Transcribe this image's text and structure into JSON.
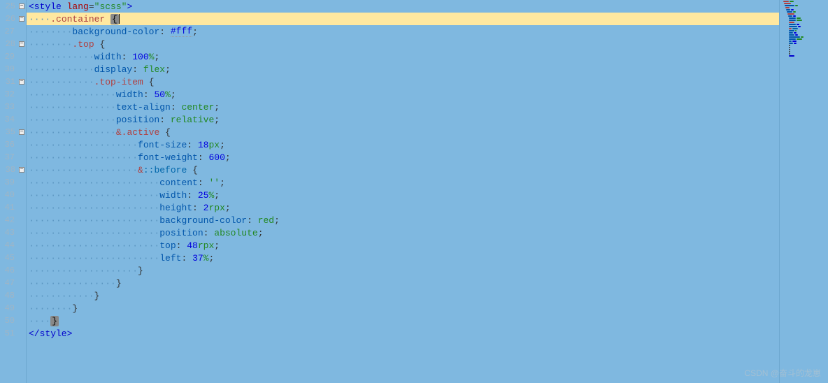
{
  "watermark": "CSDN @奋斗的龙崽",
  "startLine": 25,
  "lines": [
    {
      "n": 25,
      "fold": "-",
      "guide": "",
      "tokens": [
        [
          "tag",
          "<style "
        ],
        [
          "attr",
          "lang"
        ],
        [
          "punct",
          "="
        ],
        [
          "str",
          "\"scss\""
        ],
        [
          "tag",
          ">"
        ]
      ]
    },
    {
      "n": 26,
      "fold": "-",
      "highlight": true,
      "guide": "····",
      "tokens": [
        [
          "selcls",
          ".container "
        ],
        [
          "bracehl",
          "{"
        ]
      ],
      "cursor": true
    },
    {
      "n": 27,
      "fold": "",
      "guide": "········",
      "tokens": [
        [
          "prop",
          "background-color"
        ],
        [
          "punct",
          ": "
        ],
        [
          "num-val",
          "#fff"
        ],
        [
          "punct",
          ";"
        ]
      ],
      "underline": "#fff"
    },
    {
      "n": 28,
      "fold": "-",
      "guide": "········",
      "tokens": [
        [
          "selcls",
          ".top "
        ],
        [
          "brace",
          "{"
        ]
      ]
    },
    {
      "n": 29,
      "fold": "",
      "guide": "············",
      "tokens": [
        [
          "prop",
          "width"
        ],
        [
          "punct",
          ": "
        ],
        [
          "num-val",
          "100"
        ],
        [
          "unit",
          "%"
        ],
        [
          "punct",
          ";"
        ]
      ]
    },
    {
      "n": 30,
      "fold": "",
      "guide": "············",
      "tokens": [
        [
          "prop",
          "display"
        ],
        [
          "punct",
          ": "
        ],
        [
          "val",
          "flex"
        ],
        [
          "punct",
          ";"
        ]
      ]
    },
    {
      "n": 31,
      "fold": "-",
      "guide": "············",
      "tokens": [
        [
          "selcls",
          ".top-item "
        ],
        [
          "brace",
          "{"
        ]
      ]
    },
    {
      "n": 32,
      "fold": "",
      "guide": "················",
      "tokens": [
        [
          "prop",
          "width"
        ],
        [
          "punct",
          ": "
        ],
        [
          "num-val",
          "50"
        ],
        [
          "unit",
          "%"
        ],
        [
          "punct",
          ";"
        ]
      ]
    },
    {
      "n": 33,
      "fold": "",
      "guide": "················",
      "tokens": [
        [
          "prop",
          "text-align"
        ],
        [
          "punct",
          ": "
        ],
        [
          "val",
          "center"
        ],
        [
          "punct",
          ";"
        ]
      ]
    },
    {
      "n": 34,
      "fold": "",
      "guide": "················",
      "tokens": [
        [
          "prop",
          "position"
        ],
        [
          "punct",
          ": "
        ],
        [
          "val",
          "relative"
        ],
        [
          "punct",
          ";"
        ]
      ]
    },
    {
      "n": 35,
      "fold": "-",
      "guide": "················",
      "tokens": [
        [
          "amp",
          "&"
        ],
        [
          "selcls",
          ".active "
        ],
        [
          "brace",
          "{"
        ]
      ]
    },
    {
      "n": 36,
      "fold": "",
      "guide": "····················",
      "tokens": [
        [
          "prop",
          "font-size"
        ],
        [
          "punct",
          ": "
        ],
        [
          "num-val",
          "18"
        ],
        [
          "unit",
          "px"
        ],
        [
          "punct",
          ";"
        ]
      ]
    },
    {
      "n": 37,
      "fold": "",
      "guide": "····················",
      "tokens": [
        [
          "prop",
          "font-weight"
        ],
        [
          "punct",
          ": "
        ],
        [
          "num-val",
          "600"
        ],
        [
          "punct",
          ";"
        ]
      ]
    },
    {
      "n": 38,
      "fold": "-",
      "guide": "····················",
      "tokens": [
        [
          "amp",
          "&"
        ],
        [
          "pseudo",
          "::before "
        ],
        [
          "brace",
          "{"
        ]
      ]
    },
    {
      "n": 39,
      "fold": "",
      "guide": "························",
      "tokens": [
        [
          "prop",
          "content"
        ],
        [
          "punct",
          ": "
        ],
        [
          "str",
          "''"
        ],
        [
          "punct",
          ";"
        ]
      ]
    },
    {
      "n": 40,
      "fold": "",
      "guide": "························",
      "tokens": [
        [
          "prop",
          "width"
        ],
        [
          "punct",
          ": "
        ],
        [
          "num-val",
          "25"
        ],
        [
          "unit",
          "%"
        ],
        [
          "punct",
          ";"
        ]
      ]
    },
    {
      "n": 41,
      "fold": "",
      "guide": "························",
      "tokens": [
        [
          "prop",
          "height"
        ],
        [
          "punct",
          ": "
        ],
        [
          "num-val",
          "2"
        ],
        [
          "unit",
          "rpx"
        ],
        [
          "punct",
          ";"
        ]
      ]
    },
    {
      "n": 42,
      "fold": "",
      "guide": "························",
      "tokens": [
        [
          "prop",
          "background-color"
        ],
        [
          "punct",
          ": "
        ],
        [
          "val",
          "red"
        ],
        [
          "punct",
          ";"
        ]
      ]
    },
    {
      "n": 43,
      "fold": "",
      "guide": "························",
      "tokens": [
        [
          "prop",
          "position"
        ],
        [
          "punct",
          ": "
        ],
        [
          "val",
          "absolute"
        ],
        [
          "punct",
          ";"
        ]
      ]
    },
    {
      "n": 44,
      "fold": "",
      "guide": "························",
      "tokens": [
        [
          "prop",
          "top"
        ],
        [
          "punct",
          ": "
        ],
        [
          "num-val",
          "48"
        ],
        [
          "unit",
          "rpx"
        ],
        [
          "punct",
          ";"
        ]
      ]
    },
    {
      "n": 45,
      "fold": "",
      "guide": "························",
      "tokens": [
        [
          "prop",
          "left"
        ],
        [
          "punct",
          ": "
        ],
        [
          "num-val",
          "37"
        ],
        [
          "unit",
          "%"
        ],
        [
          "punct",
          ";"
        ]
      ]
    },
    {
      "n": 46,
      "fold": "",
      "guide": "····················",
      "tokens": [
        [
          "brace",
          "}"
        ]
      ]
    },
    {
      "n": 47,
      "fold": "",
      "guide": "················",
      "tokens": [
        [
          "brace",
          "}"
        ]
      ]
    },
    {
      "n": 48,
      "fold": "",
      "guide": "············",
      "tokens": [
        [
          "brace",
          "}"
        ]
      ]
    },
    {
      "n": 49,
      "fold": "",
      "guide": "········",
      "tokens": [
        [
          "brace",
          "}"
        ]
      ]
    },
    {
      "n": 50,
      "fold": "",
      "guide": "····",
      "tokens": [
        [
          "bracehl",
          "}"
        ]
      ]
    },
    {
      "n": 51,
      "fold": "",
      "guide": "",
      "tokens": [
        [
          "tag",
          "</style>"
        ]
      ]
    }
  ],
  "minimap": [
    [
      [
        "#b04040",
        8
      ],
      [
        "#228822",
        6
      ]
    ],
    [
      [
        "#b04040",
        10
      ]
    ],
    [
      [
        "#0055aa",
        14
      ],
      [
        "#228822",
        4
      ]
    ],
    [
      [
        "#b04040",
        6
      ]
    ],
    [
      [
        "#0055aa",
        6
      ],
      [
        "#0000dd",
        4
      ]
    ],
    [
      [
        "#0055aa",
        8
      ],
      [
        "#228822",
        4
      ]
    ],
    [
      [
        "#b04040",
        10
      ]
    ],
    [
      [
        "#0055aa",
        6
      ],
      [
        "#0000dd",
        4
      ]
    ],
    [
      [
        "#0055aa",
        10
      ],
      [
        "#228822",
        6
      ]
    ],
    [
      [
        "#0055aa",
        10
      ],
      [
        "#228822",
        8
      ]
    ],
    [
      [
        "#b04040",
        8
      ]
    ],
    [
      [
        "#0055aa",
        10
      ],
      [
        "#0000dd",
        4
      ]
    ],
    [
      [
        "#0055aa",
        12
      ],
      [
        "#0000dd",
        4
      ]
    ],
    [
      [
        "#b04040",
        4
      ],
      [
        "#0066aa",
        8
      ]
    ],
    [
      [
        "#0055aa",
        8
      ],
      [
        "#228822",
        2
      ]
    ],
    [
      [
        "#0055aa",
        6
      ],
      [
        "#0000dd",
        4
      ]
    ],
    [
      [
        "#0055aa",
        8
      ],
      [
        "#0000dd",
        4
      ]
    ],
    [
      [
        "#0055aa",
        16
      ],
      [
        "#228822",
        4
      ]
    ],
    [
      [
        "#0055aa",
        10
      ],
      [
        "#228822",
        8
      ]
    ],
    [
      [
        "#0055aa",
        4
      ],
      [
        "#0000dd",
        6
      ]
    ],
    [
      [
        "#0055aa",
        6
      ],
      [
        "#0000dd",
        4
      ]
    ],
    [
      [
        "#333",
        2
      ]
    ],
    [
      [
        "#333",
        2
      ]
    ],
    [
      [
        "#333",
        2
      ]
    ],
    [
      [
        "#333",
        2
      ]
    ],
    [
      [
        "#333",
        2
      ]
    ],
    [
      [
        "#0000cc",
        8
      ]
    ]
  ]
}
